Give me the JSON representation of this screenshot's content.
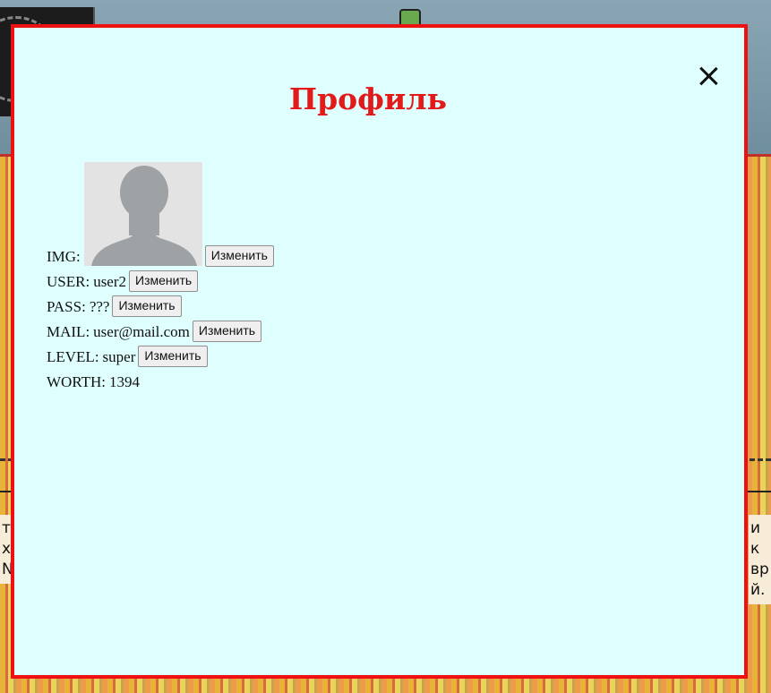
{
  "modal": {
    "title": "Профиль",
    "close_label": "×",
    "border_color": "#ee1111",
    "background_color": "#dfffff",
    "title_color": "#e21a1a"
  },
  "profile": {
    "img": {
      "label": "IMG:",
      "button": "Изменить"
    },
    "user": {
      "label": "USER:",
      "value": "user2",
      "button": "Изменить"
    },
    "pass": {
      "label": "PASS:",
      "value": "???",
      "button": "Изменить"
    },
    "mail": {
      "label": "MAIL:",
      "value": "user@mail.com",
      "button": "Изменить"
    },
    "level": {
      "label": "LEVEL:",
      "value": "super",
      "button": "Изменить"
    },
    "worth": {
      "label": "WORTH:",
      "value": "1394"
    }
  },
  "background": {
    "left_text": [
      "т",
      "х",
      "N"
    ],
    "right_text": [
      "и к",
      "вр",
      "й."
    ]
  },
  "icons": {
    "close": "close-icon",
    "avatar": "default-avatar-silhouette"
  }
}
